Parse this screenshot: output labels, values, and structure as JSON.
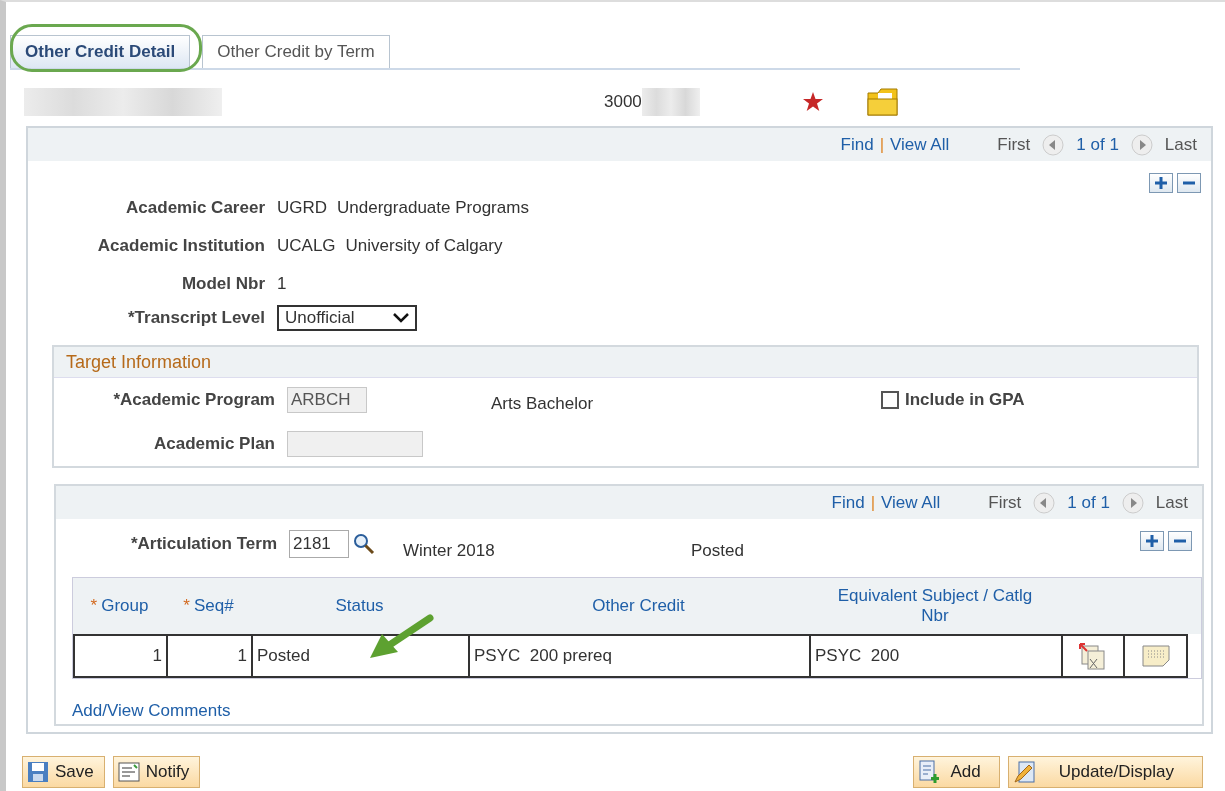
{
  "tabs": [
    {
      "label": "Other Credit Detail",
      "selected": true,
      "circled": true
    },
    {
      "label": "Other Credit by Term",
      "selected": false,
      "circled": false
    }
  ],
  "header": {
    "id_prefix": "3000"
  },
  "main_nav": {
    "find": "Find",
    "separator": "|",
    "view_all": "View All",
    "first": "First",
    "count": "1 of 1",
    "last": "Last"
  },
  "fields": [
    {
      "kind": "text",
      "label": "Academic Career",
      "values": [
        "UGRD",
        "Undergraduate Programs"
      ]
    },
    {
      "kind": "text",
      "label": "Academic Institution",
      "values": [
        "UCALG",
        "University of Calgary"
      ]
    },
    {
      "kind": "text",
      "label": "Model Nbr",
      "values": [
        "1"
      ]
    },
    {
      "kind": "dropdown",
      "label": "*Transcript Level",
      "values": [
        "Unofficial"
      ]
    }
  ],
  "target_information": {
    "title": "Target Information",
    "program_label": "*Academic Program",
    "program_value": "ARBCH",
    "program_description": "Arts Bachelor",
    "plan_label": "Academic Plan",
    "include_gpa": {
      "label": "Include in GPA",
      "checked": false
    }
  },
  "articulation": {
    "nav": {
      "find": "Find",
      "separator": "|",
      "view_all": "View All",
      "first": "First",
      "count": "1 of 1",
      "last": "Last"
    },
    "label": "*Articulation Term",
    "value": "2181",
    "term": "Winter 2018",
    "status": "Posted",
    "columns": [
      {
        "mark": "*",
        "label": "Group"
      },
      {
        "mark": "*",
        "label": "Seq#"
      },
      {
        "label": "Status"
      },
      {
        "label": "Other Credit"
      },
      {
        "label": "Equivalent Subject / Catlg Nbr"
      }
    ],
    "rows": [
      {
        "cells": [
          "1",
          "1",
          "Posted",
          "PSYC  200 prereq",
          "PSYC  200"
        ]
      }
    ],
    "comments_link": "Add/View Comments"
  },
  "buttons_left": [
    {
      "label": "Save"
    },
    {
      "label": "Notify"
    }
  ],
  "buttons_right": [
    {
      "label": "Add"
    },
    {
      "label": "Update/Display"
    }
  ]
}
